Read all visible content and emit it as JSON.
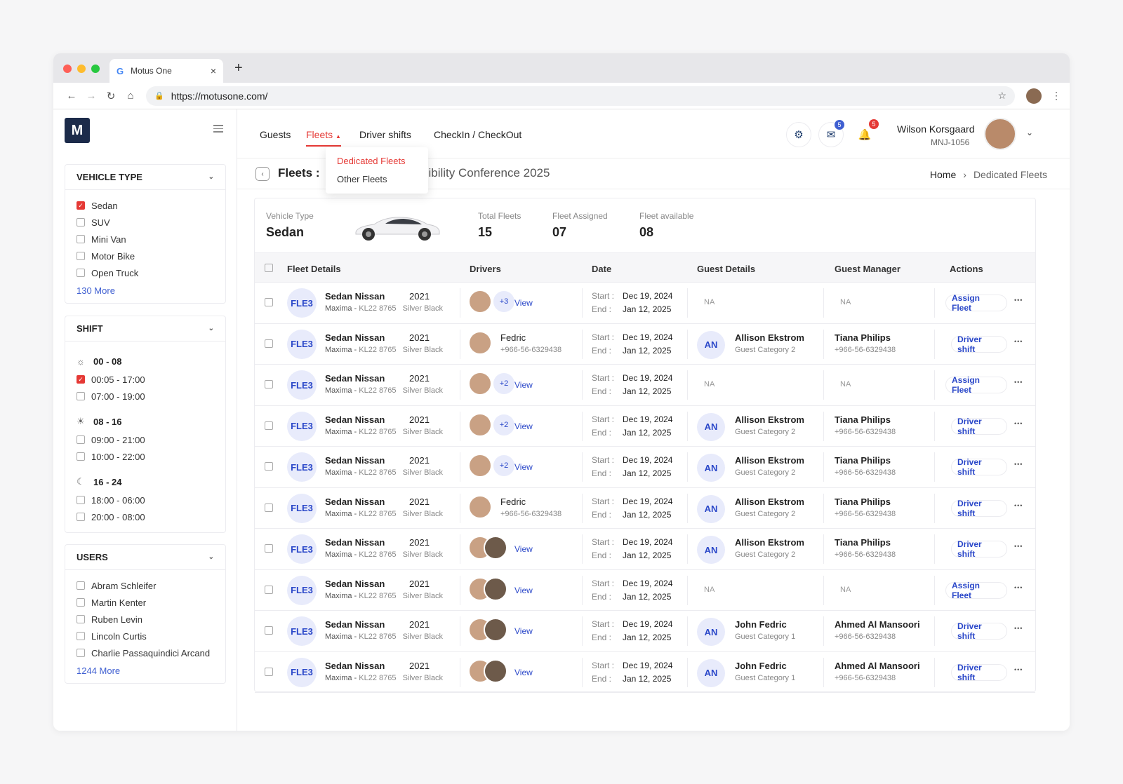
{
  "browser": {
    "tab_title": "Motus One",
    "tab_icon": "G",
    "url": "https://motusone.com/"
  },
  "logo_text": "M",
  "nav": {
    "items": [
      "Guests",
      "Fleets",
      "Driver shifts",
      "CheckIn / CheckOut"
    ],
    "active": "Fleets",
    "dropdown": [
      "Dedicated Fleets",
      "Other Fleets"
    ]
  },
  "user": {
    "name": "Wilson Korsgaard",
    "id": "MNJ-1056",
    "chat_badge": "5",
    "notif_badge": "5"
  },
  "page": {
    "title": "Fleets :",
    "title_suffix": "sibility Conference 2025",
    "breadcrumb_home": "Home",
    "breadcrumb_current": "Dedicated Fleets"
  },
  "filters": {
    "vehicle_type": {
      "title": "VEHICLE TYPE",
      "options": [
        "Sedan",
        "SUV",
        "Mini Van",
        "Motor Bike",
        "Open Truck"
      ],
      "checked": [
        "Sedan"
      ],
      "more": "130 More"
    },
    "shift": {
      "title": "SHIFT",
      "groups": [
        {
          "label": "00 - 08",
          "icon": "sunrise-icon",
          "options": [
            "00:05 - 17:00",
            "07:00 - 19:00"
          ]
        },
        {
          "label": "08 - 16",
          "icon": "sun-icon",
          "options": [
            "09:00 - 21:00",
            "10:00 - 22:00"
          ]
        },
        {
          "label": "16 - 24",
          "icon": "moon-icon",
          "options": [
            "18:00 - 06:00",
            "20:00 - 08:00"
          ]
        }
      ],
      "checked": [
        "00:05 - 17:00"
      ]
    },
    "users": {
      "title": "USERS",
      "options": [
        "Abram Schleifer",
        "Martin Kenter",
        "Ruben Levin",
        "Lincoln Curtis",
        "Charlie Passaquindici Arcand"
      ],
      "more": "1244 More"
    }
  },
  "summary": {
    "vehicle_type_label": "Vehicle Type",
    "vehicle_type": "Sedan",
    "total_label": "Total Fleets",
    "total": "15",
    "assigned_label": "Fleet Assigned",
    "assigned": "07",
    "available_label": "Fleet available",
    "available": "08"
  },
  "table": {
    "headers": [
      "Fleet Details",
      "Drivers",
      "Date",
      "Guest Details",
      "Guest Manager",
      "Actions"
    ],
    "labels": {
      "start": "Start :",
      "end": "End  :",
      "view": "View",
      "na": "NA"
    },
    "rows": [
      {
        "id": "FLE3",
        "name": "Sedan Nissan",
        "year": "2021",
        "model": "Maxima -",
        "plate": "KL22 8765",
        "color": "Silver Black",
        "driver_mode": "plus",
        "driver_extra": "+3",
        "driver_name": "",
        "driver_phone": "",
        "start": "Dec 19, 2024",
        "end": "Jan 12, 2025",
        "guest_initials": "",
        "guest_name": "",
        "guest_cat": "",
        "manager": "",
        "manager_phone": "",
        "action": "Assign Fleet"
      },
      {
        "id": "FLE3",
        "name": "Sedan Nissan",
        "year": "2021",
        "model": "Maxima -",
        "plate": "KL22 8765",
        "color": "Silver Black",
        "driver_mode": "single",
        "driver_extra": "",
        "driver_name": "Fedric",
        "driver_phone": "+966-56-6329438",
        "start": "Dec 19, 2024",
        "end": "Jan 12, 2025",
        "guest_initials": "AN",
        "guest_name": "Allison Ekstrom",
        "guest_cat": "Guest Category 2",
        "manager": "Tiana Philips",
        "manager_phone": "+966-56-6329438",
        "action": "Driver shift"
      },
      {
        "id": "FLE3",
        "name": "Sedan Nissan",
        "year": "2021",
        "model": "Maxima -",
        "plate": "KL22 8765",
        "color": "Silver Black",
        "driver_mode": "plus",
        "driver_extra": "+2",
        "driver_name": "",
        "driver_phone": "",
        "start": "Dec 19, 2024",
        "end": "Jan 12, 2025",
        "guest_initials": "",
        "guest_name": "",
        "guest_cat": "",
        "manager": "",
        "manager_phone": "",
        "action": "Assign Fleet"
      },
      {
        "id": "FLE3",
        "name": "Sedan Nissan",
        "year": "2021",
        "model": "Maxima -",
        "plate": "KL22 8765",
        "color": "Silver Black",
        "driver_mode": "plus",
        "driver_extra": "+2",
        "driver_name": "",
        "driver_phone": "",
        "start": "Dec 19, 2024",
        "end": "Jan 12, 2025",
        "guest_initials": "AN",
        "guest_name": "Allison Ekstrom",
        "guest_cat": "Guest Category 2",
        "manager": "Tiana Philips",
        "manager_phone": "+966-56-6329438",
        "action": "Driver shift"
      },
      {
        "id": "FLE3",
        "name": "Sedan Nissan",
        "year": "2021",
        "model": "Maxima -",
        "plate": "KL22 8765",
        "color": "Silver Black",
        "driver_mode": "plus",
        "driver_extra": "+2",
        "driver_name": "",
        "driver_phone": "",
        "start": "Dec 19, 2024",
        "end": "Jan 12, 2025",
        "guest_initials": "AN",
        "guest_name": "Allison Ekstrom",
        "guest_cat": "Guest Category 2",
        "manager": "Tiana Philips",
        "manager_phone": "+966-56-6329438",
        "action": "Driver shift"
      },
      {
        "id": "FLE3",
        "name": "Sedan Nissan",
        "year": "2021",
        "model": "Maxima -",
        "plate": "KL22 8765",
        "color": "Silver Black",
        "driver_mode": "single",
        "driver_extra": "",
        "driver_name": "Fedric",
        "driver_phone": "+966-56-6329438",
        "start": "Dec 19, 2024",
        "end": "Jan 12, 2025",
        "guest_initials": "AN",
        "guest_name": "Allison Ekstrom",
        "guest_cat": "Guest Category 2",
        "manager": "Tiana Philips",
        "manager_phone": "+966-56-6329438",
        "action": "Driver shift"
      },
      {
        "id": "FLE3",
        "name": "Sedan Nissan",
        "year": "2021",
        "model": "Maxima -",
        "plate": "KL22 8765",
        "color": "Silver Black",
        "driver_mode": "pair",
        "driver_extra": "",
        "driver_name": "",
        "driver_phone": "",
        "start": "Dec 19, 2024",
        "end": "Jan 12, 2025",
        "guest_initials": "AN",
        "guest_name": "Allison Ekstrom",
        "guest_cat": "Guest Category 2",
        "manager": "Tiana Philips",
        "manager_phone": "+966-56-6329438",
        "action": "Driver shift"
      },
      {
        "id": "FLE3",
        "name": "Sedan Nissan",
        "year": "2021",
        "model": "Maxima -",
        "plate": "KL22 8765",
        "color": "Silver Black",
        "driver_mode": "pair",
        "driver_extra": "",
        "driver_name": "",
        "driver_phone": "",
        "start": "Dec 19, 2024",
        "end": "Jan 12, 2025",
        "guest_initials": "",
        "guest_name": "",
        "guest_cat": "",
        "manager": "",
        "manager_phone": "",
        "action": "Assign Fleet"
      },
      {
        "id": "FLE3",
        "name": "Sedan Nissan",
        "year": "2021",
        "model": "Maxima -",
        "plate": "KL22 8765",
        "color": "Silver Black",
        "driver_mode": "pair",
        "driver_extra": "",
        "driver_name": "",
        "driver_phone": "",
        "start": "Dec 19, 2024",
        "end": "Jan 12, 2025",
        "guest_initials": "AN",
        "guest_name": "John Fedric",
        "guest_cat": "Guest Category 1",
        "manager": "Ahmed Al Mansoori",
        "manager_phone": "+966-56-6329438",
        "action": "Driver shift"
      },
      {
        "id": "FLE3",
        "name": "Sedan Nissan",
        "year": "2021",
        "model": "Maxima -",
        "plate": "KL22 8765",
        "color": "Silver Black",
        "driver_mode": "pair",
        "driver_extra": "",
        "driver_name": "",
        "driver_phone": "",
        "start": "Dec 19, 2024",
        "end": "Jan 12, 2025",
        "guest_initials": "AN",
        "guest_name": "John Fedric",
        "guest_cat": "Guest Category 1",
        "manager": "Ahmed Al Mansoori",
        "manager_phone": "+966-56-6329438",
        "action": "Driver shift"
      }
    ]
  },
  "colors": {
    "accent": "#e53935",
    "primary": "#2b48c9",
    "logo_bg": "#1c2b4a"
  }
}
